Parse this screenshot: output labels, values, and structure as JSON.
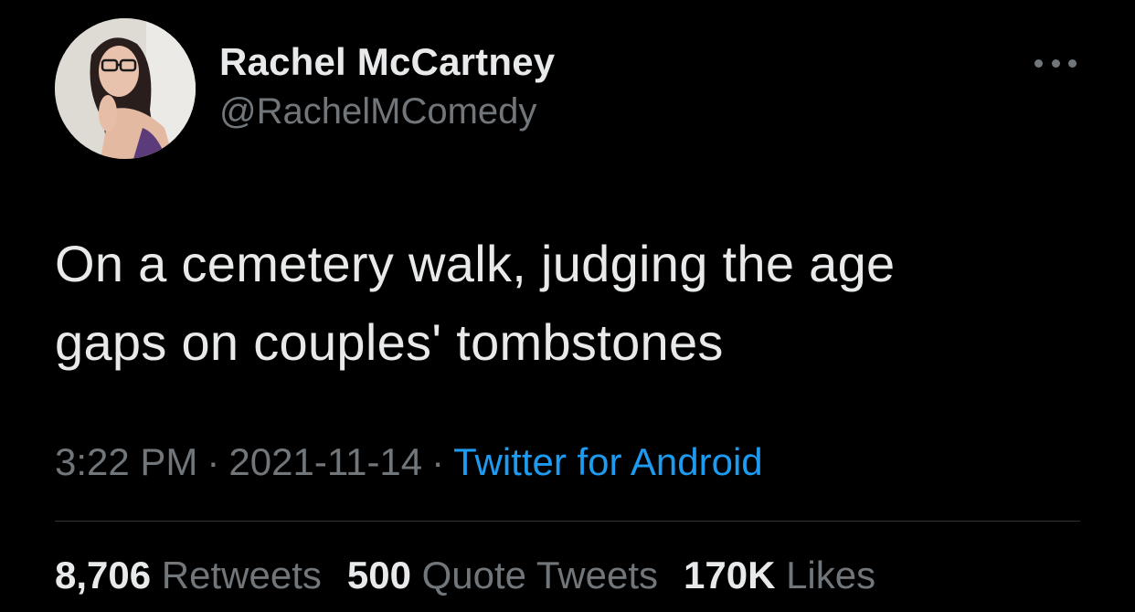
{
  "tweet": {
    "author": {
      "name": "Rachel McCartney",
      "handle": "@RachelMComedy",
      "avatar_icon": "profile-photo"
    },
    "more_icon": "more-horizontal-icon",
    "text_lines": [
      "On a cemetery walk, judging the age",
      "gaps on couples' tombstones"
    ],
    "meta": {
      "time": "3:22 PM",
      "separator": "·",
      "date": "2021-11-14",
      "source": "Twitter for Android"
    },
    "stats": {
      "retweets_count": "8,706",
      "retweets_label": "Retweets",
      "quotes_count": "500",
      "quotes_label": "Quote Tweets",
      "likes_count": "170K",
      "likes_label": "Likes"
    }
  },
  "colors": {
    "background": "#000000",
    "primary_text": "#e7e9ea",
    "secondary_text": "#71767b",
    "link": "#1d9bf0",
    "divider": "#2f3336"
  }
}
